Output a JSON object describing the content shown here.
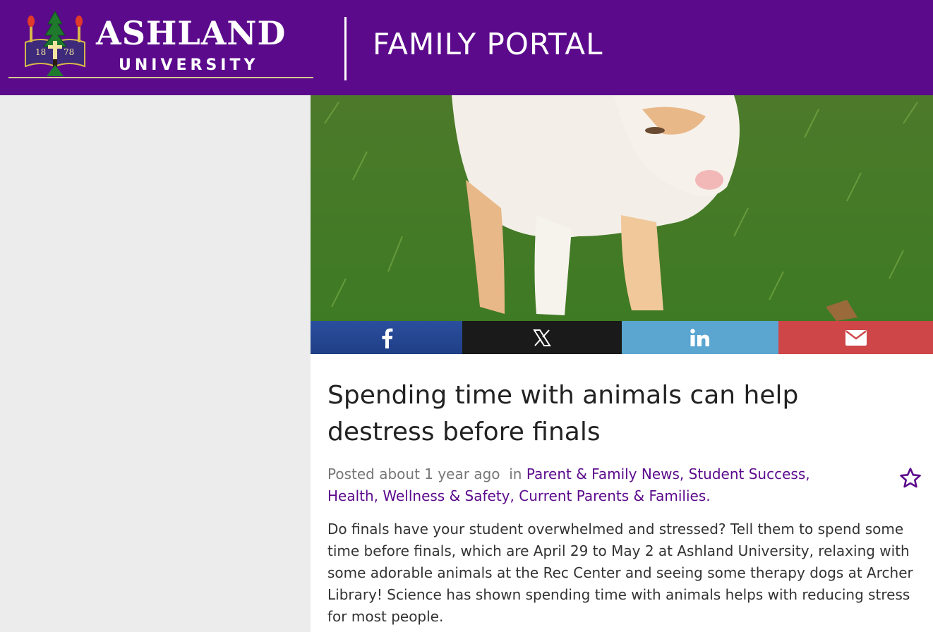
{
  "header": {
    "logo_name": "ASHLAND",
    "logo_sub": "UNIVERSITY",
    "logo_year_left": "18",
    "logo_year_right": "78",
    "portal_title": "FAMILY PORTAL",
    "bg_color": "#5b0a8c"
  },
  "share": {
    "facebook_icon": "facebook-icon",
    "x_icon": "x-icon",
    "linkedin_icon": "linkedin-icon",
    "email_icon": "envelope-icon",
    "facebook_color": "#2b4f9e",
    "x_color": "#1a1a1a",
    "linkedin_color": "#5aa6d0",
    "email_color": "#cf4648"
  },
  "article": {
    "headline": "Spending time with animals can help destress before finals",
    "posted": "Posted about 1 year ago",
    "in_label": "in",
    "categories": [
      "Parent & Family News",
      "Student Success",
      "Health, Wellness & Safety",
      "Current Parents & Families."
    ],
    "body": "Do finals have your student overwhelmed and stressed? Tell them to spend some time before finals, which are April 29 to May 2 at Ashland University, relaxing with some adorable animals at the Rec Center and seeing some therapy dogs at Archer Library! Science has shown spending time with animals helps with reducing stress for most people.",
    "favorite_icon": "star-outline-icon",
    "link_color": "#5b0a8c"
  }
}
